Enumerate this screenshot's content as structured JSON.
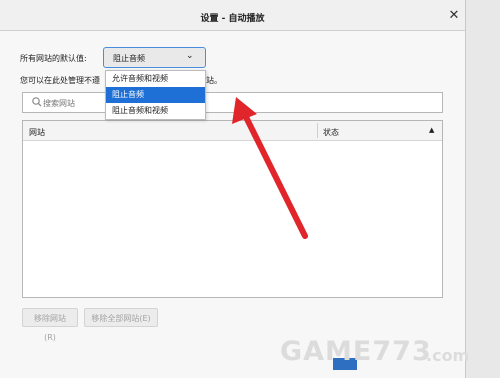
{
  "dialog": {
    "title": "设置 - 自动播放",
    "close_glyph": "✕"
  },
  "default_setting": {
    "label": "所有网站的默认值:",
    "selected_value": "阻止音频",
    "caret_glyph": "⌄"
  },
  "dropdown": {
    "options": [
      "允许音频和视频",
      "阻止音频",
      "阻止音频和视频"
    ],
    "selected_index": 1
  },
  "manage_text_prefix": "您可以在此处管理不遵",
  "manage_text_suffix": "站。",
  "search": {
    "placeholder": "搜索网站"
  },
  "table": {
    "columns": [
      "网站",
      "状态"
    ],
    "sort_glyph": "▲",
    "rows": []
  },
  "buttons": {
    "remove_site": "移除网站(R)",
    "remove_all": "移除全部网站(E)"
  },
  "watermark": {
    "text": "GAME773",
    "suffix": ".com"
  },
  "colors": {
    "accent": "#1e6fd6",
    "annotation_arrow": "#e0252b"
  }
}
